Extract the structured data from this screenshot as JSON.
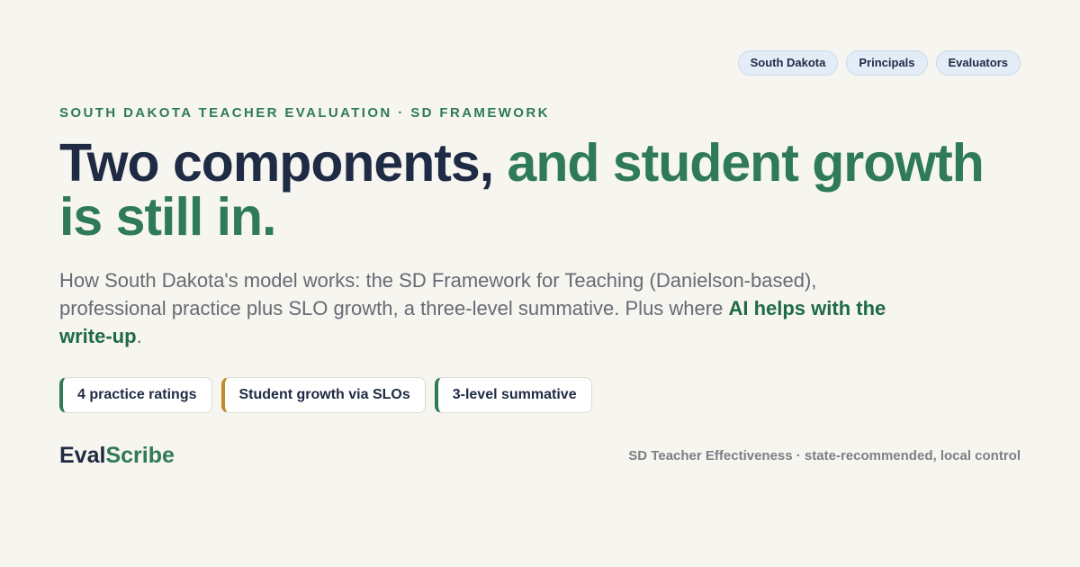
{
  "tags": [
    "South Dakota",
    "Principals",
    "Evaluators"
  ],
  "eyebrow": "SOUTH DAKOTA TEACHER EVALUATION · SD FRAMEWORK",
  "headline": {
    "part1": "Two components, ",
    "part2": "and student growth is still in."
  },
  "description": {
    "text": "How South Dakota's model works: the SD Framework for Teaching (Danielson-based), professional practice plus SLO growth, a three-level summative. Plus where ",
    "highlight": "AI helps with the write-up",
    "end": "."
  },
  "chips": [
    {
      "label": "4 practice ratings",
      "accent": "#2f7a57"
    },
    {
      "label": "Student growth via SLOs",
      "accent": "#c08a2c"
    },
    {
      "label": "3-level summative",
      "accent": "#2f7a57"
    }
  ],
  "brand": {
    "part1": "Eval",
    "part2": "Scribe"
  },
  "tagline": "SD Teacher Effectiveness · state-recommended, local control",
  "colors": {
    "background": "#f6f5ef",
    "navy": "#1f2a44",
    "green": "#2f7a57",
    "gold": "#c08a2c",
    "tag_bg": "#e3ecf7"
  }
}
